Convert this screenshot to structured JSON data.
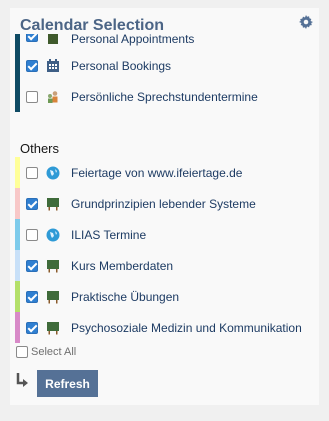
{
  "header": {
    "title": "Calendar Selection",
    "settings_icon": "gear-icon"
  },
  "personal": {
    "items": [
      {
        "label": "Personal Appointments",
        "checked": true,
        "icon": "person-calendar-icon",
        "color": "#0f4b64"
      },
      {
        "label": "Personal Bookings",
        "checked": true,
        "icon": "calendar-grid-icon",
        "color": "#0f4b64"
      },
      {
        "label": "Persönliche Sprechstundentermine",
        "checked": false,
        "icon": "people-icon",
        "color": "#0f4b64"
      }
    ]
  },
  "others": {
    "title": "Others",
    "items": [
      {
        "label": "Feiertage von www.ifeiertage.de",
        "checked": false,
        "icon": "globe-icon",
        "color": "#ffff99"
      },
      {
        "label": "Grundprinzipien lebender Systeme",
        "checked": true,
        "icon": "course-board-icon",
        "color": "#f8c8c8"
      },
      {
        "label": "ILIAS Termine",
        "checked": false,
        "icon": "globe-icon",
        "color": "#7ecbeb"
      },
      {
        "label": "Kurs Memberdaten",
        "checked": true,
        "icon": "course-board-icon",
        "color": "#c8e0f8"
      },
      {
        "label": "Praktische Übungen",
        "checked": true,
        "icon": "course-board-icon",
        "color": "#b4e06a"
      },
      {
        "label": "Psychosoziale Medizin und Kommunikation",
        "checked": true,
        "icon": "course-board-icon",
        "color": "#d88ac8"
      }
    ]
  },
  "footer": {
    "select_all_label": "Select All",
    "select_all_checked": false,
    "refresh_label": "Refresh",
    "arrow_icon": "return-arrow-icon"
  }
}
